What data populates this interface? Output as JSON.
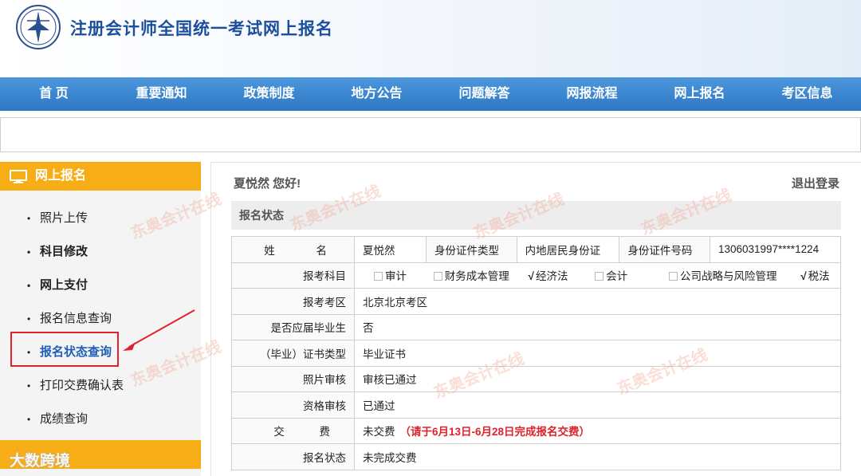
{
  "header": {
    "title": "注册会计师全国统一考试网上报名"
  },
  "nav": [
    "首  页",
    "重要通知",
    "政策制度",
    "地方公告",
    "问题解答",
    "网报流程",
    "网上报名",
    "考区信息"
  ],
  "sidebar": {
    "heading": "网上报名",
    "items": [
      {
        "label": "照片上传"
      },
      {
        "label": "科目修改"
      },
      {
        "label": "网上支付"
      },
      {
        "label": "报名信息查询"
      },
      {
        "label": "报名状态查询"
      },
      {
        "label": "打印交费确认表"
      },
      {
        "label": "成绩查询"
      }
    ],
    "watermark": "大数跨境"
  },
  "content": {
    "greeting": "夏悦然 您好!",
    "logout": "退出登录",
    "section_title": "报名状态",
    "row_name": {
      "label": "姓  名",
      "value": "夏悦然",
      "id_type_label": "身份证件类型",
      "id_type_value": "内地居民身份证",
      "id_no_label": "身份证件号码",
      "id_no_value": "1306031997****1224"
    },
    "subjects_label": "报考科目",
    "subjects": [
      {
        "name": "审计",
        "checked": false
      },
      {
        "name": "财务成本管理",
        "checked": false
      },
      {
        "name": "经济法",
        "checked": true
      },
      {
        "name": "会计",
        "checked": false
      },
      {
        "name": "公司战略与风险管理",
        "checked": false
      },
      {
        "name": "税法",
        "checked": true
      }
    ],
    "rows": [
      {
        "label": "报考考区",
        "value": "北京北京考区"
      },
      {
        "label": "是否应届毕业生",
        "value": "否"
      },
      {
        "label": "（毕业）证书类型",
        "value": "毕业证书"
      },
      {
        "label": "照片审核",
        "value": "审核已通过"
      },
      {
        "label": "资格审核",
        "value": "已通过"
      }
    ],
    "fee": {
      "label": "交  费",
      "value": "未交费",
      "notice": "（请于6月13日-6月28日完成报名交费）"
    },
    "status": {
      "label": "报名状态",
      "value": "未完成交费"
    }
  },
  "watermark_text": "东奥会计在线",
  "watermark_url": "www.dongao.com",
  "colors": {
    "nav": "#3583d0",
    "sidebar_head": "#f6ad16",
    "title": "#1b4f9c",
    "warn": "#e0232a"
  }
}
